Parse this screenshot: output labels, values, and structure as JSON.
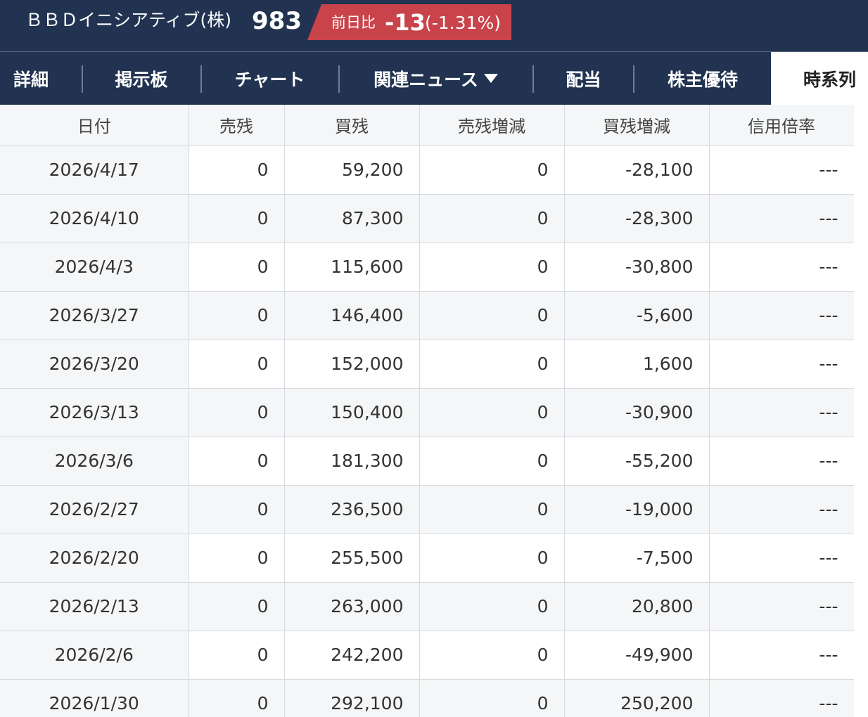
{
  "header": {
    "company_name": "ＢＢＤイニシアティブ(株)",
    "price": "983",
    "change_label": "前日比",
    "change_value": "-13",
    "change_percent": "(-1.31%)",
    "change_color": "#c9434a",
    "bg_color": "#213350"
  },
  "nav": {
    "items": [
      {
        "label": "詳細"
      },
      {
        "label": "掲示板"
      },
      {
        "label": "チャート"
      },
      {
        "label": "関連ニュース",
        "icon": "caret-down-icon"
      },
      {
        "label": "配当"
      },
      {
        "label": "株主優待"
      },
      {
        "label": "時系列",
        "active": true
      }
    ]
  },
  "table": {
    "columns": [
      "日付",
      "売残",
      "買残",
      "売残増減",
      "買残増減",
      "信用倍率"
    ],
    "rows": [
      [
        "2026/4/17",
        "0",
        "59,200",
        "0",
        "-28,100",
        "---"
      ],
      [
        "2026/4/10",
        "0",
        "87,300",
        "0",
        "-28,300",
        "---"
      ],
      [
        "2026/4/3",
        "0",
        "115,600",
        "0",
        "-30,800",
        "---"
      ],
      [
        "2026/3/27",
        "0",
        "146,400",
        "0",
        "-5,600",
        "---"
      ],
      [
        "2026/3/20",
        "0",
        "152,000",
        "0",
        "1,600",
        "---"
      ],
      [
        "2026/3/13",
        "0",
        "150,400",
        "0",
        "-30,900",
        "---"
      ],
      [
        "2026/3/6",
        "0",
        "181,300",
        "0",
        "-55,200",
        "---"
      ],
      [
        "2026/2/27",
        "0",
        "236,500",
        "0",
        "-19,000",
        "---"
      ],
      [
        "2026/2/20",
        "0",
        "255,500",
        "0",
        "-7,500",
        "---"
      ],
      [
        "2026/2/13",
        "0",
        "263,000",
        "0",
        "20,800",
        "---"
      ],
      [
        "2026/2/6",
        "0",
        "242,200",
        "0",
        "-49,900",
        "---"
      ],
      [
        "2026/1/30",
        "0",
        "292,100",
        "0",
        "250,200",
        "---"
      ]
    ]
  }
}
